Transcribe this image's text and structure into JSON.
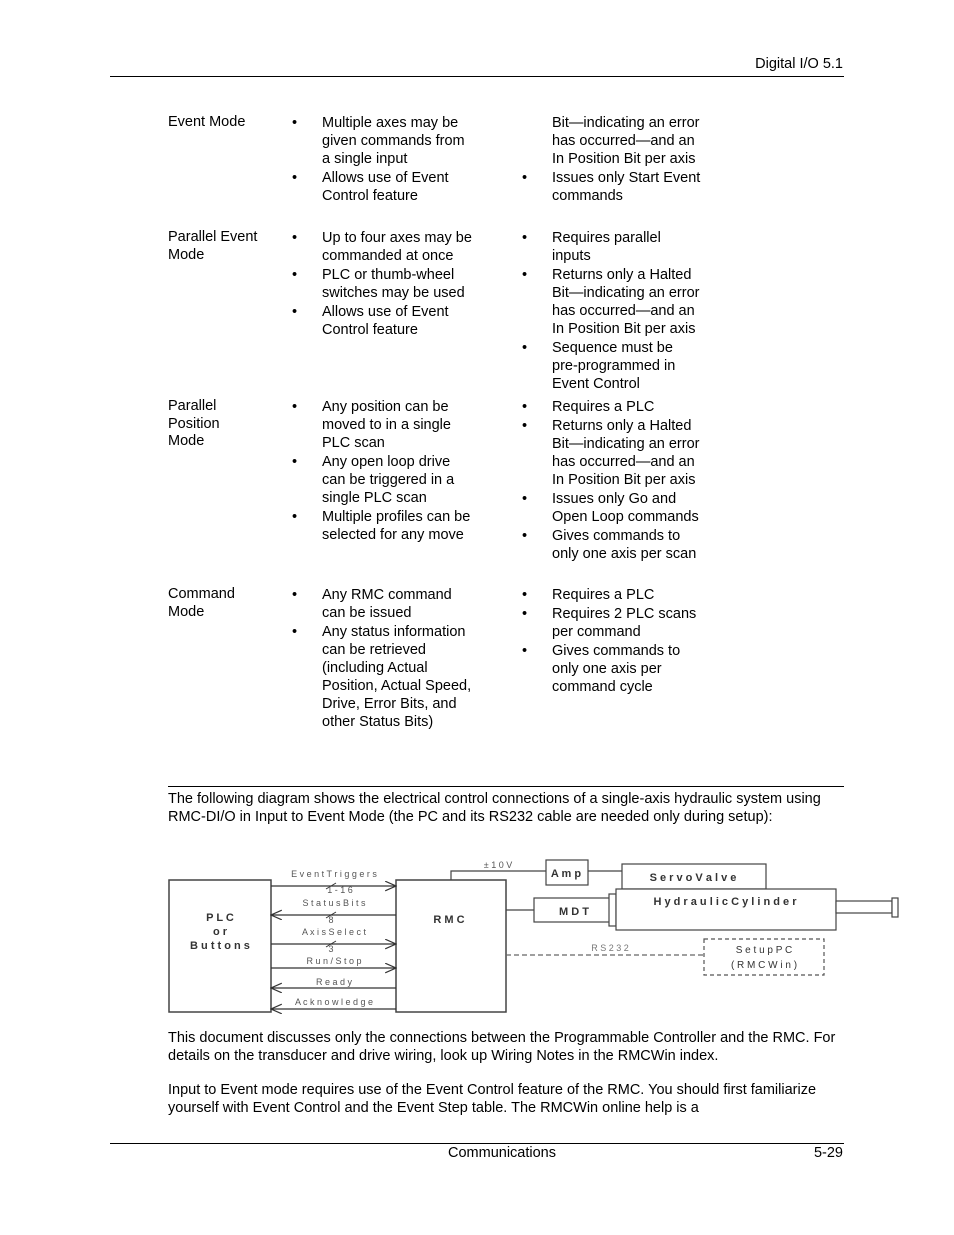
{
  "header": {
    "section": "Digital I/O  5.1"
  },
  "table": {
    "rows": [
      {
        "mode": "Event Mode",
        "pros": [
          "Multiple axes may be given commands from a single input",
          "Allows use of Event Control feature"
        ],
        "cons_continued": "Bit—indicating an error has occurred—and an In Position Bit per axis",
        "cons": [
          "Issues only Start Event commands"
        ]
      },
      {
        "mode": "Parallel Event Mode",
        "pros": [
          "Up to four axes may be commanded at once",
          "PLC or thumb-wheel switches may be used",
          "Allows use of Event Control feature"
        ],
        "cons": [
          "Requires parallel inputs",
          "Returns only a Halted Bit—indicating an error has occurred—and an In Position Bit per axis",
          "Sequence must be pre-programmed in Event Control"
        ]
      },
      {
        "mode": "Parallel Position Mode",
        "pros": [
          "Any position can be moved to in a single PLC scan",
          "Any open loop drive can be triggered in a single PLC scan",
          "Multiple profiles can be selected for any move"
        ],
        "cons": [
          "Requires a PLC",
          "Returns only a Halted Bit—indicating an error has occurred—and an In Position Bit per axis",
          "Issues only Go and Open Loop commands",
          "Gives commands to only one axis per scan"
        ]
      },
      {
        "mode": "Command Mode",
        "pros": [
          "Any RMC command can be issued",
          "Any status information can be retrieved (including Actual Position, Actual Speed, Drive, Error Bits, and other Status Bits)"
        ],
        "cons": [
          "Requires a PLC",
          "Requires 2 PLC scans per command",
          "Gives commands to only one axis per command cycle"
        ]
      }
    ],
    "bullet": "•"
  },
  "paragraphs": {
    "intro": "The following diagram shows the electrical control connections of a single-axis hydraulic system using RMC-DI/O in Input to Event Mode (the PC and its RS232 cable are needed only during setup):",
    "p2": "This document discusses only the connections between the Programmable Controller and the RMC. For details on the transducer and drive wiring, look up Wiring Notes in the RMCWin index.",
    "p3": "Input to Event mode requires use of the Event Control feature of the RMC. You should first familiarize yourself with Event Control and the Event Step table. The RMCWin online help is a"
  },
  "diagram": {
    "plc_box": [
      "P L C",
      "o r",
      "B u t t o n s"
    ],
    "rmc_box": "R M C",
    "signals": [
      {
        "label": "E v e n t  T r i g g e r s",
        "direction": "to-rmc",
        "bus_width": "1 - 1 6"
      },
      {
        "label": "S t a t u s  B i t s",
        "direction": "to-plc",
        "bus_width": "8"
      },
      {
        "label": "A x i s  S e l e c t",
        "direction": "to-rmc",
        "bus_width": "3"
      },
      {
        "label": "R u n / S t o p",
        "direction": "to-rmc",
        "bus_width": ""
      },
      {
        "label": "R e a d y",
        "direction": "to-plc",
        "bus_width": ""
      },
      {
        "label": "A c k n o w l e d g e",
        "direction": "to-plc",
        "bus_width": ""
      }
    ],
    "voltage_label": "± 1 0 V",
    "amp": "A m p",
    "servo_valve": "S e r v o  V a l v e",
    "mdt": "M D T",
    "cylinder": "H y d r a u l i c  C y l i n d e r",
    "rs232": "R S 2 3 2",
    "setup_pc": [
      "S e t u p  P C",
      "( R M C W i n )"
    ]
  },
  "footer": {
    "chapter": "Communications",
    "page": "5-29"
  }
}
